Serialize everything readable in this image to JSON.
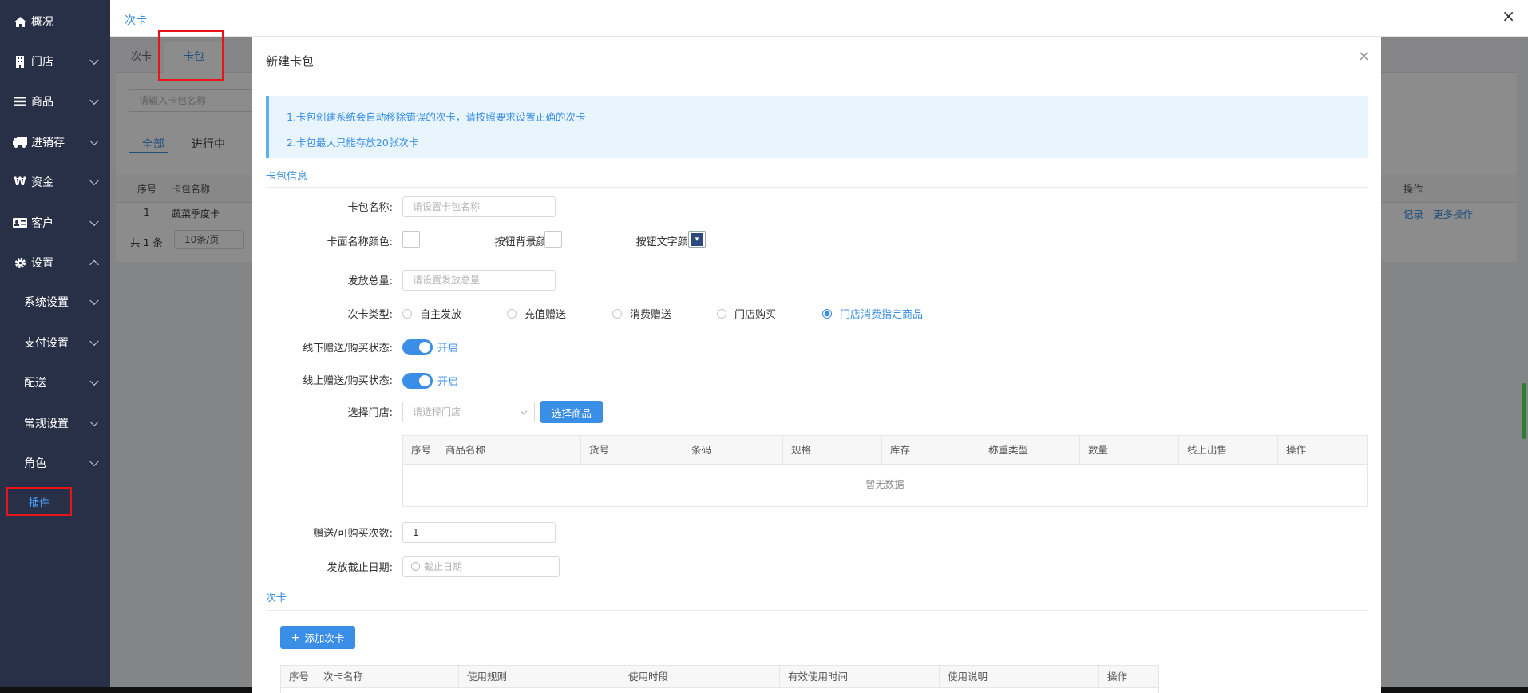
{
  "sidebar": {
    "items": [
      {
        "label": "概况",
        "icon": "home-icon"
      },
      {
        "label": "门店",
        "icon": "store-icon"
      },
      {
        "label": "商品",
        "icon": "list-icon"
      },
      {
        "label": "进销存",
        "icon": "truck-icon"
      },
      {
        "label": "资金",
        "icon": "won-icon"
      },
      {
        "label": "客户",
        "icon": "id-card-icon"
      },
      {
        "label": "设置",
        "icon": "gear-icon"
      }
    ],
    "sub_items": [
      "系统设置",
      "支付设置",
      "配送",
      "常规设置",
      "角色"
    ],
    "plugin_label": "插件"
  },
  "header": {
    "title": "次卡",
    "close": "×"
  },
  "under": {
    "tabs": [
      "次卡",
      "卡包"
    ],
    "search_placeholder": "请输入卡包名称",
    "filters": [
      "全部",
      "进行中"
    ],
    "table_headers": [
      "序号",
      "卡包名称",
      "操作"
    ],
    "row": {
      "index": "1",
      "name": "蔬菜季度卡",
      "actions": [
        "记录",
        "更多操作"
      ]
    },
    "pagination": {
      "total": "共 1 条",
      "page_size": "10条/页"
    }
  },
  "modal": {
    "title": "新建卡包",
    "close": "×",
    "tips": [
      "1.卡包创建系统会自动移除错误的次卡，请按照要求设置正确的次卡",
      "2.卡包最大只能存放20张次卡"
    ],
    "section_info": "卡包信息",
    "form": {
      "name_label": "卡包名称:",
      "name_placeholder": "请设置卡包名称",
      "card_color_label": "卡面名称颜色:",
      "btn_bg_label": "按钮背景颜色:",
      "btn_text_label": "按钮文字颜色:",
      "total_label": "发放总量:",
      "total_placeholder": "请设置发放总量",
      "type_label": "次卡类型:",
      "types": [
        "自主发放",
        "充值赠送",
        "消费赠送",
        "门店购买",
        "门店消费指定商品"
      ],
      "offline_label": "线下赠送/购买状态:",
      "offline_state": "开启",
      "online_label": "线上赠送/购买状态:",
      "online_state": "开启",
      "store_label": "选择门店:",
      "store_placeholder": "请选择门店",
      "select_goods_btn": "选择商品",
      "goods_headers": [
        "序号",
        "商品名称",
        "货号",
        "条码",
        "规格",
        "库存",
        "称重类型",
        "数量",
        "线上出售",
        "操作"
      ],
      "goods_empty": "暂无数据",
      "count_label": "赠送/可购买次数:",
      "count_value": "1",
      "deadline_label": "发放截止日期:",
      "deadline_placeholder": "截止日期"
    },
    "section_cards": "次卡",
    "add_card_btn": "添加次卡",
    "cards_headers": [
      "序号",
      "次卡名称",
      "使用规则",
      "使用时段",
      "有效使用时间",
      "使用说明",
      "操作"
    ]
  }
}
